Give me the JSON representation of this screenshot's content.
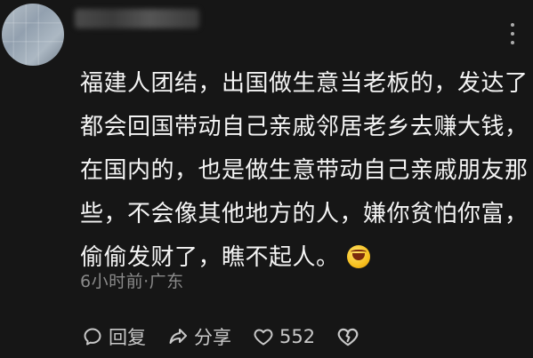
{
  "comment": {
    "lines": [
      "福建人团结，出国做生意当老板的，发达了",
      "都会回国带动自己亲戚邻居老乡去赚大钱，",
      "在国内的，也是做生意带动自己亲戚朋友那",
      "些，不会像其他地方的人，嫌你贫怕你富，",
      "偷偷发财了，瞧不起人。"
    ],
    "emoji": "laughing-tears-emoji",
    "time": "6小时前",
    "separator": "·",
    "location": "广东"
  },
  "actions": {
    "reply_label": "回复",
    "share_label": "分享",
    "like_count": "552"
  },
  "icons": {
    "reply": "reply-bubble-icon",
    "share": "share-arrow-icon",
    "like": "heart-icon",
    "unlike": "broken-heart-icon",
    "menu": "more-dots-icon"
  }
}
